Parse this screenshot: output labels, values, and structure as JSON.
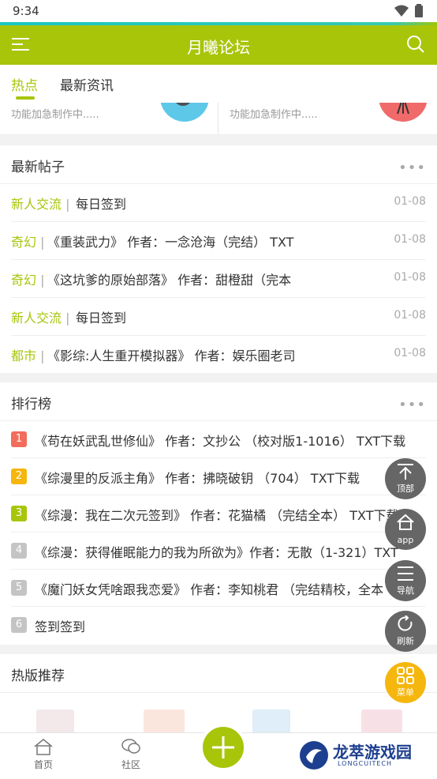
{
  "status_bar": {
    "time": "9:34"
  },
  "app_bar": {
    "title": "月曦论坛"
  },
  "tabs": [
    {
      "label": "热点",
      "active": true
    },
    {
      "label": "最新资讯",
      "active": false
    }
  ],
  "features": [
    {
      "text": "功能加急制作中....."
    },
    {
      "text": "功能加急制作中....."
    }
  ],
  "latest_posts": {
    "title": "最新帖子",
    "more": "•••",
    "items": [
      {
        "category": "新人交流",
        "sep": " | ",
        "title": "每日签到",
        "date": "01-08"
      },
      {
        "category": "奇幻",
        "sep": " | ",
        "title": "《重装武力》 作者：一念沧海（完结） TXT",
        "date": "01-08"
      },
      {
        "category": "奇幻",
        "sep": " | ",
        "title": "《这坑爹的原始部落》 作者：甜橙甜（完本",
        "date": "01-08"
      },
      {
        "category": "新人交流",
        "sep": " | ",
        "title": "每日签到",
        "date": "01-08"
      },
      {
        "category": "都市",
        "sep": " | ",
        "title": "《影综:人生重开模拟器》 作者：娱乐圈老司",
        "date": "01-08"
      }
    ]
  },
  "ranking": {
    "title": "排行榜",
    "more": "•••",
    "items": [
      {
        "rank": "1",
        "color": "#f26d5b",
        "title": "《苟在妖武乱世修仙》 作者：文抄公 （校对版1-1016） TXT下载"
      },
      {
        "rank": "2",
        "color": "#f5b60e",
        "title": "《综漫里的反派主角》 作者：拂晓破钥 （704） TXT下载"
      },
      {
        "rank": "3",
        "color": "#a8c50a",
        "title": "《综漫：我在二次元签到》 作者：花猫橘 （完结全本） TXT下载"
      },
      {
        "rank": "4",
        "color": "#c4c4c4",
        "title": "《综漫：获得催眠能力的我为所欲为》作者：无散（1-321）TXT"
      },
      {
        "rank": "5",
        "color": "#c4c4c4",
        "title": "《魔门妖女凭啥跟我恋爱》 作者：李知桃君 （完结精校，全本"
      },
      {
        "rank": "6",
        "color": "#c4c4c4",
        "title": "签到签到"
      }
    ]
  },
  "hot_section": {
    "title": "热版推荐"
  },
  "fabs": [
    {
      "label": "顶部",
      "icon": "arrow-up-icon"
    },
    {
      "label": "app",
      "icon": "home-icon"
    },
    {
      "label": "导航",
      "icon": "menu-icon"
    },
    {
      "label": "刷新",
      "icon": "refresh-icon"
    },
    {
      "label": "菜单",
      "icon": "grid-icon"
    }
  ],
  "bottom_nav": [
    {
      "label": "首页",
      "icon": "home-icon"
    },
    {
      "label": "社区",
      "icon": "chat-icon"
    }
  ],
  "watermark": {
    "text": "龙萃游戏园",
    "subtext": "LONGCUITECH"
  },
  "colors": {
    "accent": "#a8c50a",
    "fab": "#666666",
    "fab_menu": "#f5b60e"
  }
}
